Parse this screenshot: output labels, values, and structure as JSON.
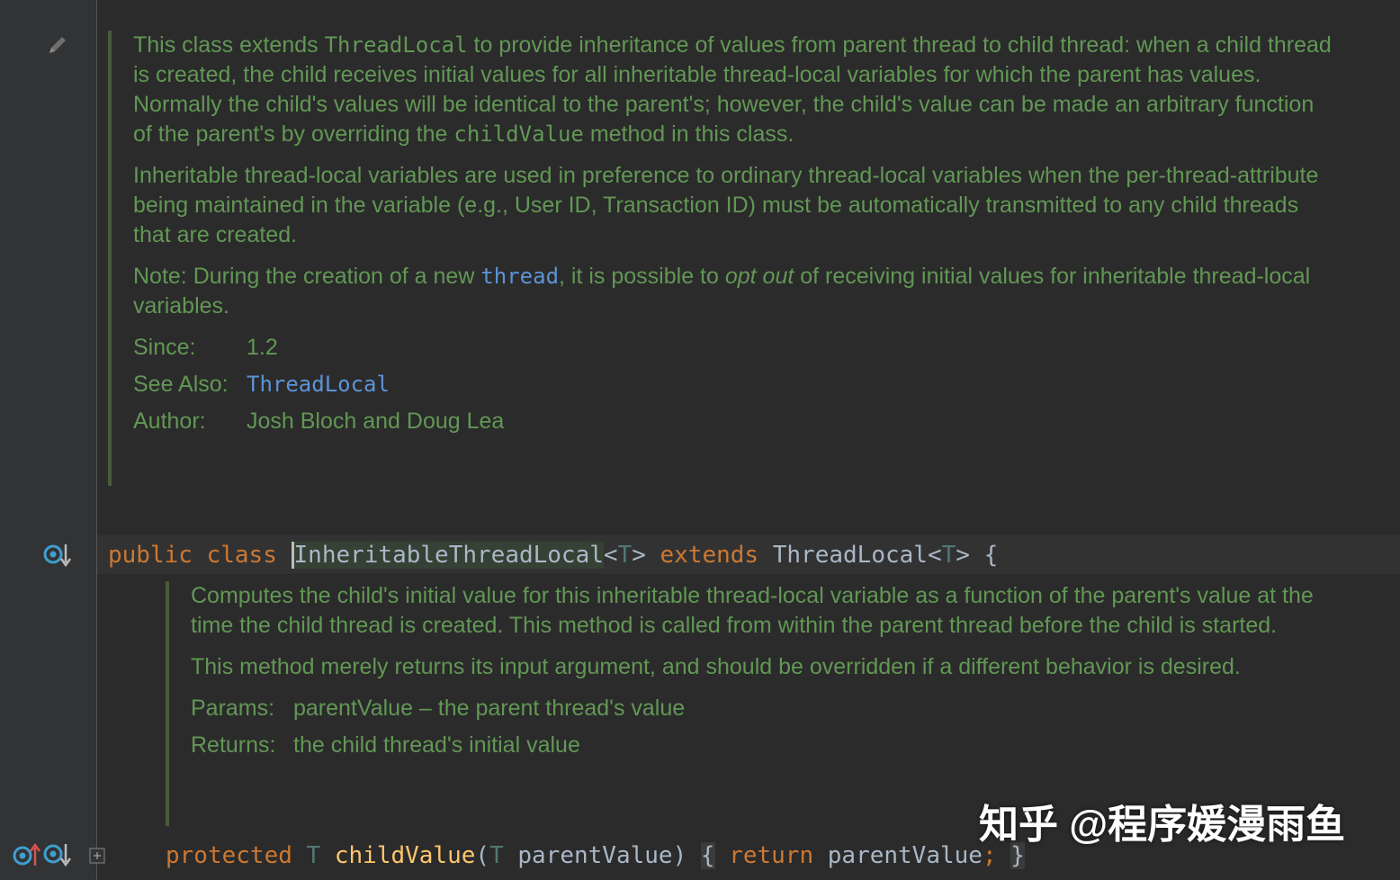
{
  "class_doc": {
    "p1_a": "This class extends ",
    "p1_code1": "ThreadLocal",
    "p1_b": " to provide inheritance of values from parent thread to child thread: when a child thread is created, the child receives initial values for all inheritable thread-local variables for which the parent has values. Normally the child's values will be identical to the parent's; however, the child's value can be made an arbitrary function of the parent's by overriding the ",
    "p1_code2": "childValue",
    "p1_c": " method in this class.",
    "p2": "Inheritable thread-local variables are used in preference to ordinary thread-local variables when the per-thread-attribute being maintained in the variable (e.g., User ID, Transaction ID) must be automatically transmitted to any child threads that are created.",
    "p3_a": "Note: During the creation of a new ",
    "p3_link": "thread",
    "p3_b": ", it is possible to ",
    "p3_italic": "opt out",
    "p3_c": " of receiving initial values for inheritable thread-local variables.",
    "since_label": "Since:",
    "since_value": "1.2",
    "see_also_label": "See Also:",
    "see_also_value": "ThreadLocal",
    "author_label": "Author:",
    "author_value": "Josh Bloch and Doug Lea"
  },
  "class_decl": {
    "kw_public": "public",
    "kw_class": "class",
    "name": "InheritableThreadLocal",
    "lt": "<",
    "type_param": "T",
    "gt": ">",
    "kw_extends": "extends",
    "super_name": "ThreadLocal",
    "lt2": "<",
    "type_param2": "T",
    "gt2": ">",
    "brace": "{"
  },
  "method_doc": {
    "p1": "Computes the child's initial value for this inheritable thread-local variable as a function of the parent's value at the time the child thread is created. This method is called from within the parent thread before the child is started.",
    "p2": "This method merely returns its input argument, and should be overridden if a different behavior is desired.",
    "params_label": "Params:",
    "params_value": "parentValue – the parent thread's value",
    "returns_label": "Returns:",
    "returns_value": "the child thread's initial value"
  },
  "method_decl": {
    "kw_protected": "protected",
    "ret_type": "T",
    "name": "childValue",
    "paren_open": "(",
    "param_type": "T",
    "param_name": "parentValue",
    "paren_close": ")",
    "brace_open": "{",
    "kw_return": "return",
    "ret_value": "parentValue",
    "semicolon": ";",
    "brace_close": "}"
  },
  "icons": {
    "edit": "pencil-icon",
    "class_marker": "implemented-down-icon",
    "method_up": "overrides-up-icon",
    "method_down": "overridden-down-icon",
    "fold": "fold-plus-icon"
  },
  "colors": {
    "background": "#2b2b2b",
    "gutter": "#313335",
    "doc_text": "#629755",
    "keyword": "#cc7832",
    "link": "#5c93d6",
    "function": "#ffc66d"
  },
  "watermark": "知乎 @程序媛漫雨鱼"
}
